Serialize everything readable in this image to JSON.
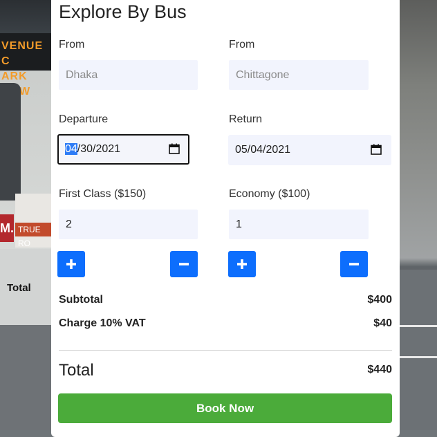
{
  "background": {
    "bus_sign": [
      "VENUE C",
      "ARK ROW"
    ],
    "bus_ad_brand": "M.",
    "bus_ad_text": "TRUE RO",
    "bus_side_label": "Total"
  },
  "page": {
    "title": "Explore By Bus",
    "from_left_label": "From",
    "from_left_placeholder": "Dhaka",
    "from_right_label": "From",
    "from_right_placeholder": "Chittagone",
    "departure_label": "Departure",
    "departure_month": "04",
    "departure_rest": "/30/2021",
    "return_label": "Return",
    "return_value": "05/04/2021",
    "first_class_label": "First Class ($150)",
    "first_class_value": "2",
    "economy_label": "Economy ($100)",
    "economy_value": "1",
    "subtotal_label": "Subtotal",
    "subtotal_value": "$400",
    "vat_label": "Charge 10% VAT",
    "vat_value": "$40",
    "total_label": "Total",
    "total_value": "$440",
    "book_label": "Book Now"
  },
  "colors": {
    "primary": "#0d6efd",
    "success": "#4bab3a",
    "input_bg": "#f2f4fd"
  },
  "icons": {
    "plus": "plus-icon",
    "minus": "minus-icon",
    "calendar": "calendar-icon"
  }
}
